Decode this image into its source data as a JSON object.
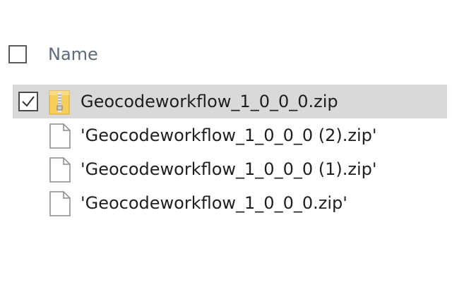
{
  "header": {
    "name_label": "Name"
  },
  "files": [
    {
      "name": "Geocodeworkflow_1_0_0_0.zip",
      "selected": true,
      "icon": "zip-folder-icon"
    },
    {
      "name": "'Geocodeworkflow_1_0_0_0 (2).zip'",
      "selected": false,
      "icon": "blank-file-icon"
    },
    {
      "name": "'Geocodeworkflow_1_0_0_0 (1).zip'",
      "selected": false,
      "icon": "blank-file-icon"
    },
    {
      "name": "'Geocodeworkflow_1_0_0_0.zip'",
      "selected": false,
      "icon": "blank-file-icon"
    }
  ],
  "colors": {
    "selection": "#d9d9d9",
    "header_text": "#5f6b7a",
    "zip_folder": "#f2c94c"
  }
}
